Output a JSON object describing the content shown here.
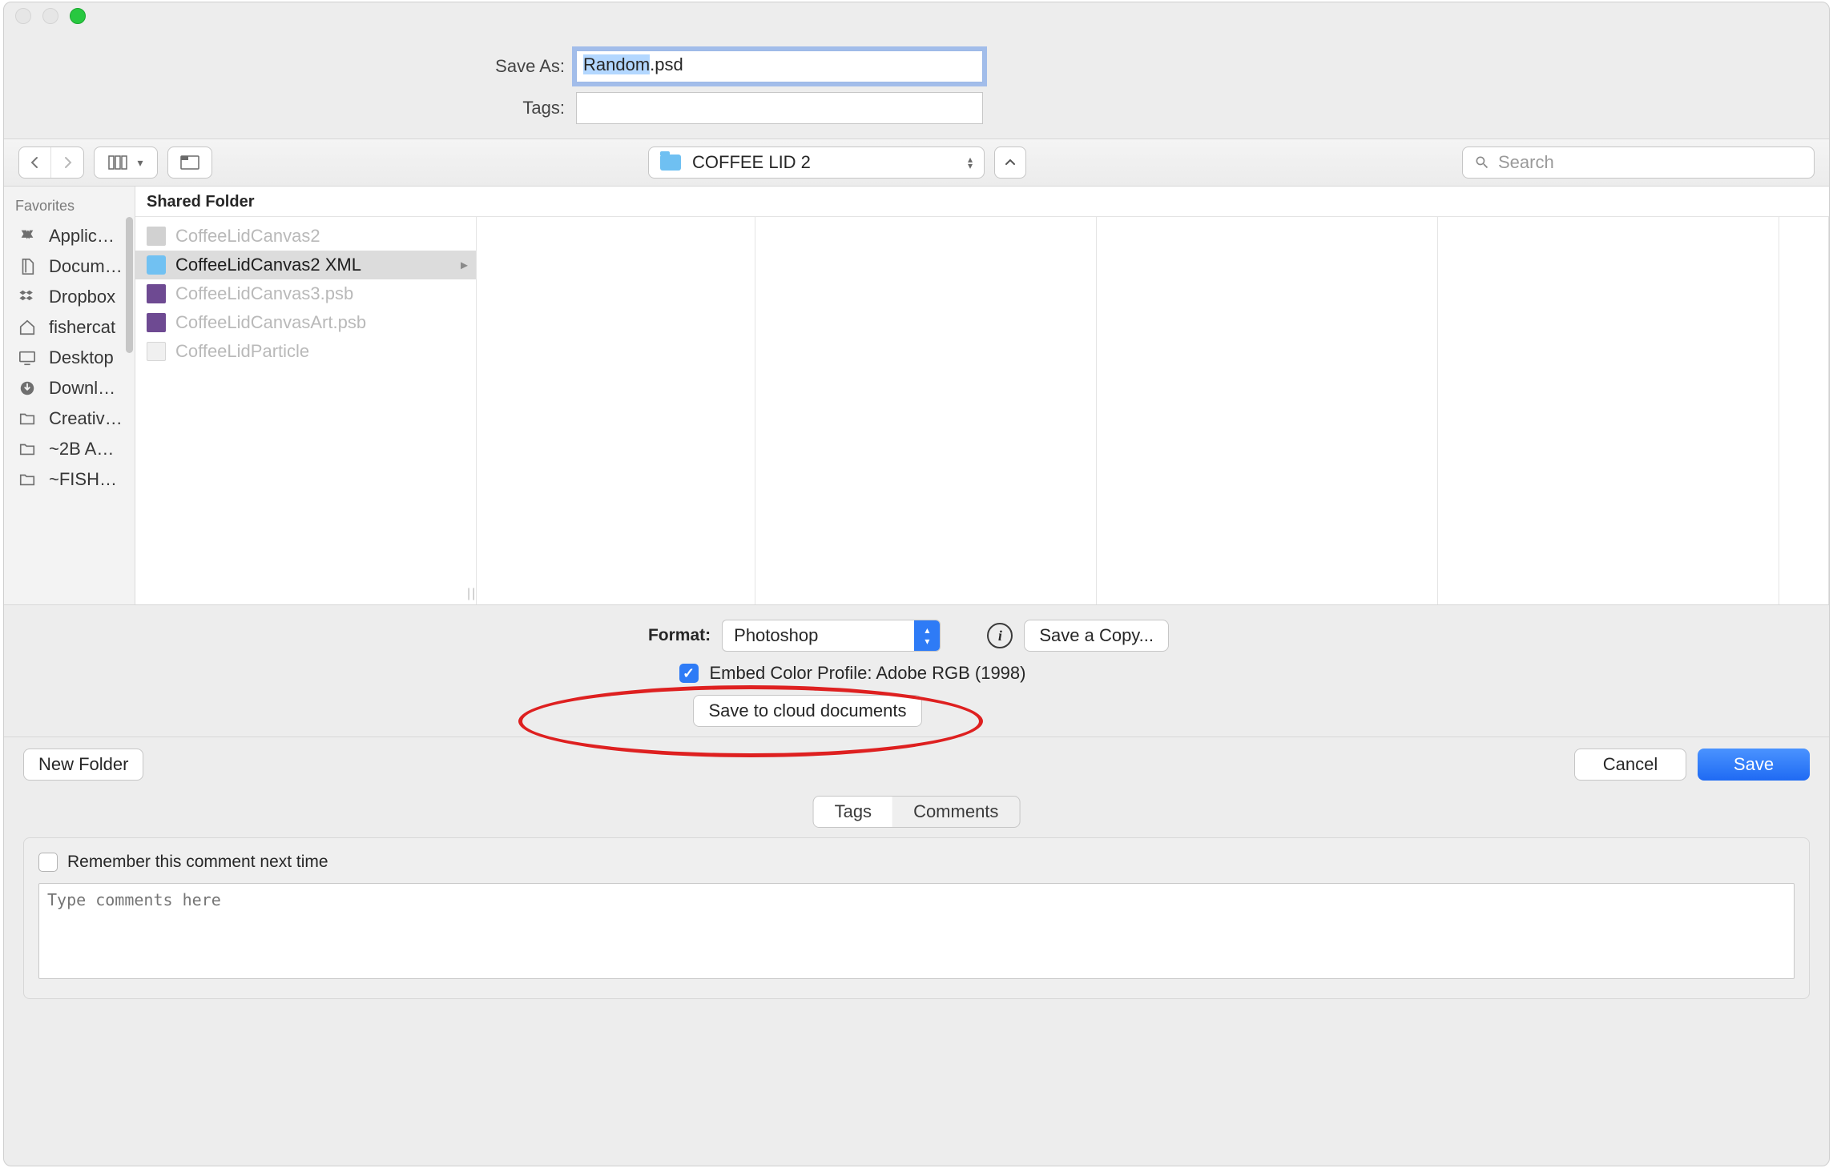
{
  "header": {
    "save_as_label": "Save As:",
    "tags_label": "Tags:",
    "filename_selected": "Random",
    "filename_rest": ".psd"
  },
  "toolbar": {
    "folder_name": "COFFEE LID 2",
    "search_placeholder": "Search"
  },
  "sidebar": {
    "heading": "Favorites",
    "items": [
      {
        "label": "Applicati..."
      },
      {
        "label": "Docume..."
      },
      {
        "label": "Dropbox"
      },
      {
        "label": "fishercat"
      },
      {
        "label": "Desktop"
      },
      {
        "label": "Downloa..."
      },
      {
        "label": "Creative..."
      },
      {
        "label": "~2B AR..."
      },
      {
        "label": "~FISHER..."
      }
    ]
  },
  "column": {
    "header": "Shared Folder",
    "files": [
      {
        "name": "CoffeeLidCanvas2",
        "kind": "img",
        "disabled": true
      },
      {
        "name": "CoffeeLidCanvas2 XML",
        "kind": "folder",
        "selected": true,
        "chevron": true
      },
      {
        "name": "CoffeeLidCanvas3.psb",
        "kind": "psb",
        "disabled": true
      },
      {
        "name": "CoffeeLidCanvasArt.psb",
        "kind": "psb",
        "disabled": true
      },
      {
        "name": "CoffeeLidParticle",
        "kind": "doc",
        "disabled": true
      }
    ]
  },
  "options": {
    "format_label": "Format:",
    "format_value": "Photoshop",
    "save_copy_label": "Save a Copy...",
    "embed_label": "Embed Color Profile:  Adobe RGB (1998)",
    "cloud_label": "Save to cloud documents"
  },
  "footer": {
    "new_folder": "New Folder",
    "cancel": "Cancel",
    "save": "Save"
  },
  "comments": {
    "tab_tags": "Tags",
    "tab_comments": "Comments",
    "remember": "Remember this comment next time",
    "placeholder": "Type comments here"
  }
}
